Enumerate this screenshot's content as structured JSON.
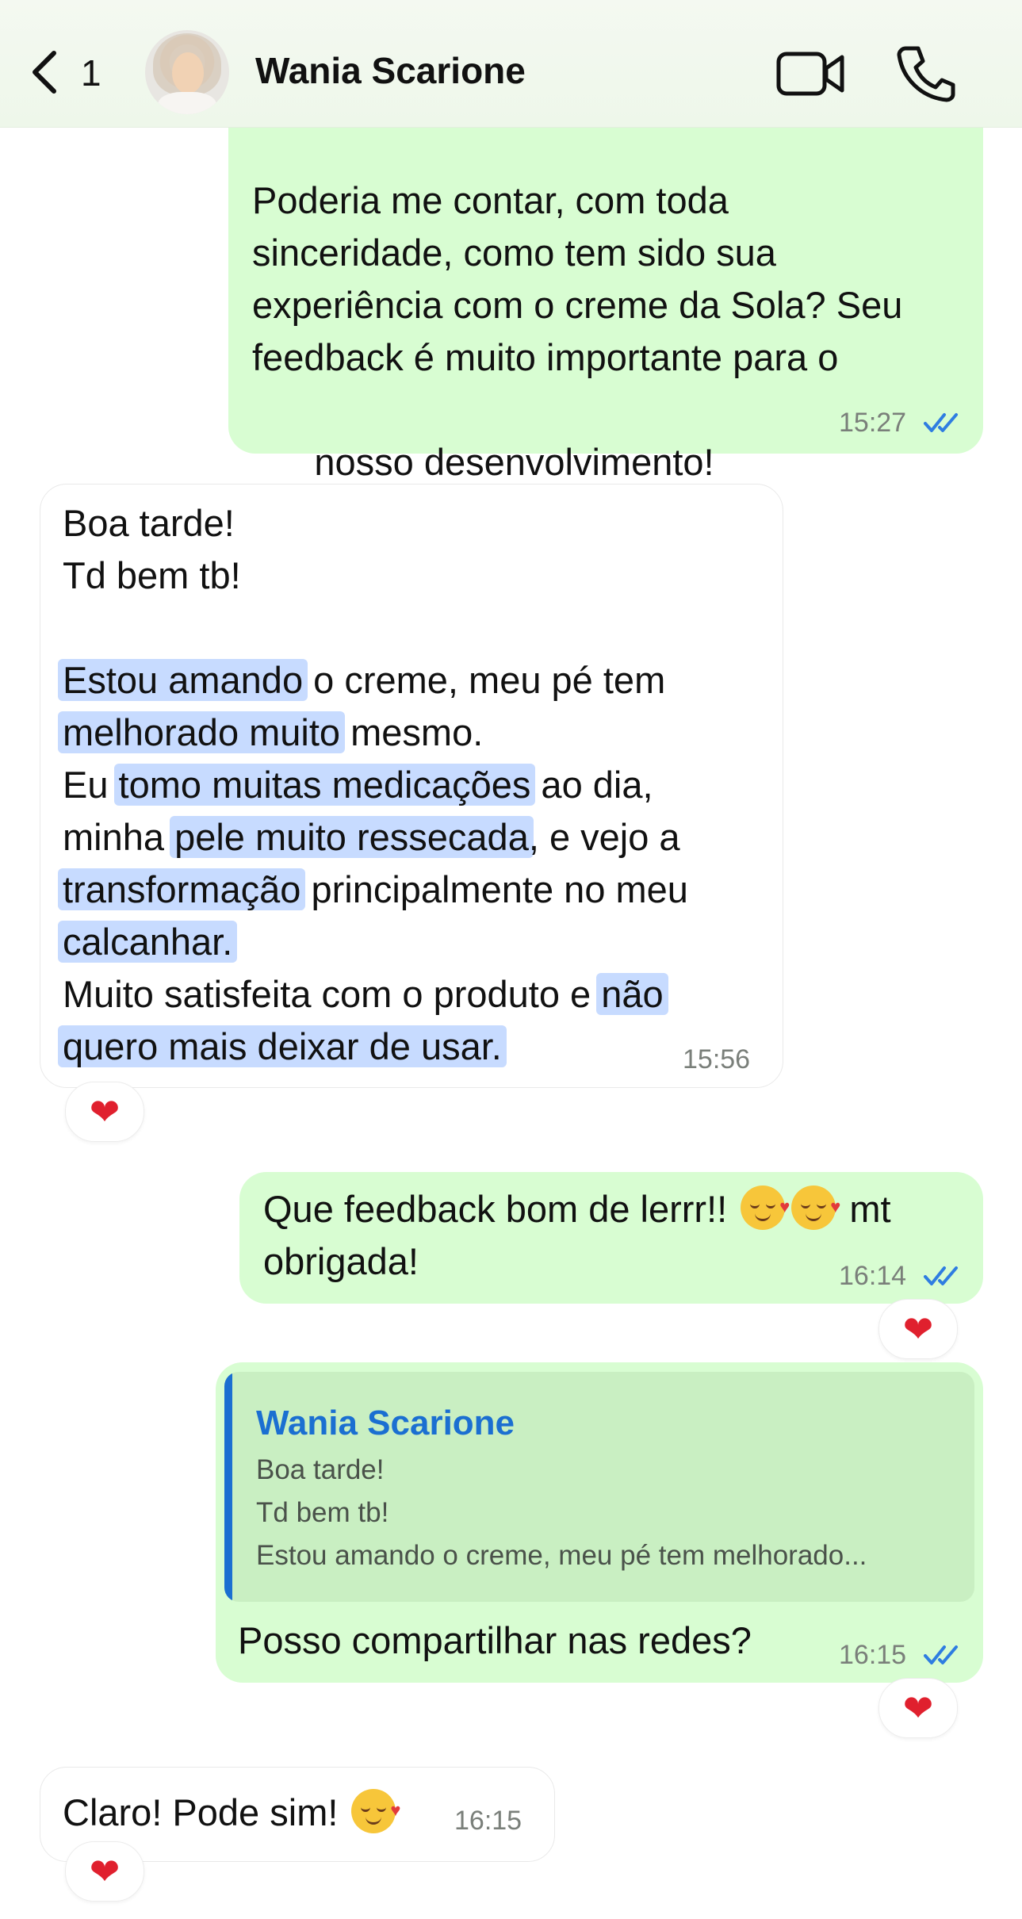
{
  "header": {
    "back_count": "1",
    "contact_name": "Wania Scarione",
    "avatar_icon": "contact-avatar-photo",
    "video_icon": "video-camera-icon",
    "call_icon": "phone-icon"
  },
  "colors": {
    "outgoing_bubble": "#d8fdd2",
    "incoming_bubble": "#ffffff",
    "highlight": "#c7dbff",
    "read_ticks": "#2f7de1",
    "quote_accent": "#1b6fd1",
    "reaction_heart": "#e0202e"
  },
  "messages": {
    "m1": {
      "lines": [
        "Poderia me contar, com toda",
        "sinceridade, como tem sido sua",
        "experiência com o creme da Sola? Seu",
        "feedback é muito importante para o",
        "nosso desenvolvimento!"
      ],
      "emoji": "💛",
      "time": "15:27",
      "status": "read"
    },
    "m2": {
      "l1": "Boa tarde!",
      "l2": "Td bem tb!",
      "l3a": "Estou amando",
      "l3b": " o creme, meu pé tem",
      "l4a": "melhorado muito",
      "l4b": " mesmo.",
      "l5a": "Eu ",
      "l5b": "tomo muitas medicações",
      "l5c": " ao dia,",
      "l6a": "minha ",
      "l6b": "pele muito ressecada",
      "l6c": ", e vejo a",
      "l7a": "transformação",
      "l7b": " principalmente no meu",
      "l8a": "calcanhar.",
      "l9a": "Muito satisfeita com o produto e ",
      "l9b": "não",
      "l10a": "quero mais deixar de usar.",
      "time": "15:56",
      "reaction": "❤"
    },
    "m3": {
      "line1a": "Que feedback bom de lerrr!!",
      "line1b": "mt",
      "line2": "obrigada!",
      "time": "16:14",
      "status": "read",
      "reaction": "❤"
    },
    "m4": {
      "quote_name": "Wania Scarione",
      "quote_lines": [
        "Boa tarde!",
        "Td bem tb!",
        "Estou amando o creme, meu pé tem melhorado..."
      ],
      "text": "Posso compartilhar nas redes?",
      "time": "16:15",
      "status": "read",
      "reaction": "❤"
    },
    "m5": {
      "text": "Claro! Pode sim!",
      "time": "16:15",
      "reaction": "❤"
    }
  }
}
